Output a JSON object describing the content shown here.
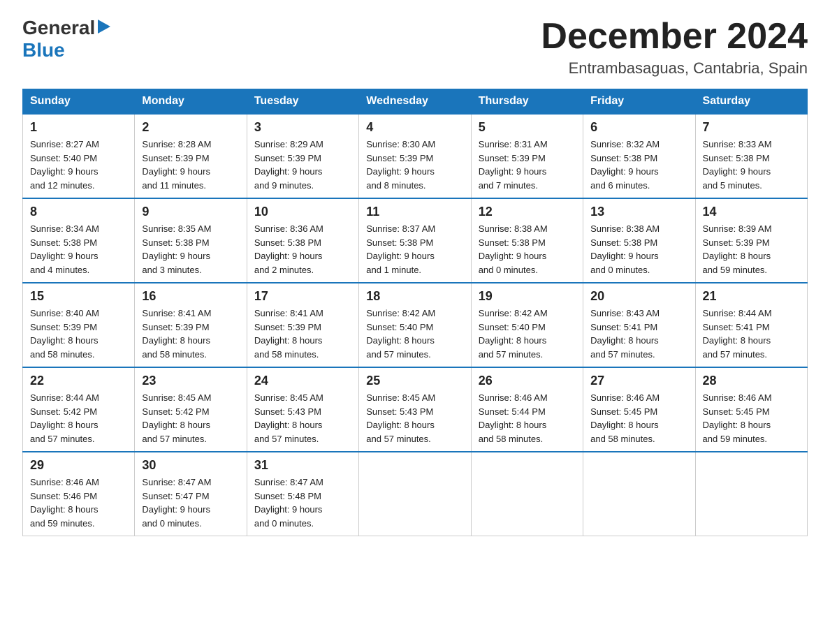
{
  "header": {
    "logo_general": "General",
    "logo_blue": "Blue",
    "month_title": "December 2024",
    "location": "Entrambasaguas, Cantabria, Spain"
  },
  "weekdays": [
    "Sunday",
    "Monday",
    "Tuesday",
    "Wednesday",
    "Thursday",
    "Friday",
    "Saturday"
  ],
  "weeks": [
    [
      {
        "day": "1",
        "sunrise": "8:27 AM",
        "sunset": "5:40 PM",
        "daylight": "9 hours and 12 minutes."
      },
      {
        "day": "2",
        "sunrise": "8:28 AM",
        "sunset": "5:39 PM",
        "daylight": "9 hours and 11 minutes."
      },
      {
        "day": "3",
        "sunrise": "8:29 AM",
        "sunset": "5:39 PM",
        "daylight": "9 hours and 9 minutes."
      },
      {
        "day": "4",
        "sunrise": "8:30 AM",
        "sunset": "5:39 PM",
        "daylight": "9 hours and 8 minutes."
      },
      {
        "day": "5",
        "sunrise": "8:31 AM",
        "sunset": "5:39 PM",
        "daylight": "9 hours and 7 minutes."
      },
      {
        "day": "6",
        "sunrise": "8:32 AM",
        "sunset": "5:38 PM",
        "daylight": "9 hours and 6 minutes."
      },
      {
        "day": "7",
        "sunrise": "8:33 AM",
        "sunset": "5:38 PM",
        "daylight": "9 hours and 5 minutes."
      }
    ],
    [
      {
        "day": "8",
        "sunrise": "8:34 AM",
        "sunset": "5:38 PM",
        "daylight": "9 hours and 4 minutes."
      },
      {
        "day": "9",
        "sunrise": "8:35 AM",
        "sunset": "5:38 PM",
        "daylight": "9 hours and 3 minutes."
      },
      {
        "day": "10",
        "sunrise": "8:36 AM",
        "sunset": "5:38 PM",
        "daylight": "9 hours and 2 minutes."
      },
      {
        "day": "11",
        "sunrise": "8:37 AM",
        "sunset": "5:38 PM",
        "daylight": "9 hours and 1 minute."
      },
      {
        "day": "12",
        "sunrise": "8:38 AM",
        "sunset": "5:38 PM",
        "daylight": "9 hours and 0 minutes."
      },
      {
        "day": "13",
        "sunrise": "8:38 AM",
        "sunset": "5:38 PM",
        "daylight": "9 hours and 0 minutes."
      },
      {
        "day": "14",
        "sunrise": "8:39 AM",
        "sunset": "5:39 PM",
        "daylight": "8 hours and 59 minutes."
      }
    ],
    [
      {
        "day": "15",
        "sunrise": "8:40 AM",
        "sunset": "5:39 PM",
        "daylight": "8 hours and 58 minutes."
      },
      {
        "day": "16",
        "sunrise": "8:41 AM",
        "sunset": "5:39 PM",
        "daylight": "8 hours and 58 minutes."
      },
      {
        "day": "17",
        "sunrise": "8:41 AM",
        "sunset": "5:39 PM",
        "daylight": "8 hours and 58 minutes."
      },
      {
        "day": "18",
        "sunrise": "8:42 AM",
        "sunset": "5:40 PM",
        "daylight": "8 hours and 57 minutes."
      },
      {
        "day": "19",
        "sunrise": "8:42 AM",
        "sunset": "5:40 PM",
        "daylight": "8 hours and 57 minutes."
      },
      {
        "day": "20",
        "sunrise": "8:43 AM",
        "sunset": "5:41 PM",
        "daylight": "8 hours and 57 minutes."
      },
      {
        "day": "21",
        "sunrise": "8:44 AM",
        "sunset": "5:41 PM",
        "daylight": "8 hours and 57 minutes."
      }
    ],
    [
      {
        "day": "22",
        "sunrise": "8:44 AM",
        "sunset": "5:42 PM",
        "daylight": "8 hours and 57 minutes."
      },
      {
        "day": "23",
        "sunrise": "8:45 AM",
        "sunset": "5:42 PM",
        "daylight": "8 hours and 57 minutes."
      },
      {
        "day": "24",
        "sunrise": "8:45 AM",
        "sunset": "5:43 PM",
        "daylight": "8 hours and 57 minutes."
      },
      {
        "day": "25",
        "sunrise": "8:45 AM",
        "sunset": "5:43 PM",
        "daylight": "8 hours and 57 minutes."
      },
      {
        "day": "26",
        "sunrise": "8:46 AM",
        "sunset": "5:44 PM",
        "daylight": "8 hours and 58 minutes."
      },
      {
        "day": "27",
        "sunrise": "8:46 AM",
        "sunset": "5:45 PM",
        "daylight": "8 hours and 58 minutes."
      },
      {
        "day": "28",
        "sunrise": "8:46 AM",
        "sunset": "5:45 PM",
        "daylight": "8 hours and 59 minutes."
      }
    ],
    [
      {
        "day": "29",
        "sunrise": "8:46 AM",
        "sunset": "5:46 PM",
        "daylight": "8 hours and 59 minutes."
      },
      {
        "day": "30",
        "sunrise": "8:47 AM",
        "sunset": "5:47 PM",
        "daylight": "9 hours and 0 minutes."
      },
      {
        "day": "31",
        "sunrise": "8:47 AM",
        "sunset": "5:48 PM",
        "daylight": "9 hours and 0 minutes."
      },
      null,
      null,
      null,
      null
    ]
  ],
  "labels": {
    "sunrise": "Sunrise:",
    "sunset": "Sunset:",
    "daylight": "Daylight:"
  }
}
